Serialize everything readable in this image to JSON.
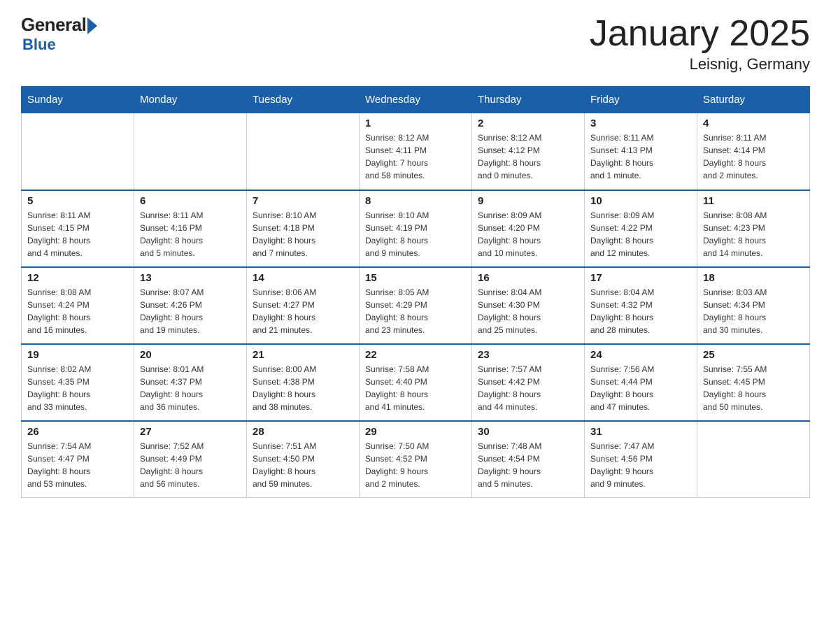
{
  "header": {
    "logo_general": "General",
    "logo_blue": "Blue",
    "title": "January 2025",
    "subtitle": "Leisnig, Germany"
  },
  "days_of_week": [
    "Sunday",
    "Monday",
    "Tuesday",
    "Wednesday",
    "Thursday",
    "Friday",
    "Saturday"
  ],
  "weeks": [
    [
      {
        "day": "",
        "info": ""
      },
      {
        "day": "",
        "info": ""
      },
      {
        "day": "",
        "info": ""
      },
      {
        "day": "1",
        "info": "Sunrise: 8:12 AM\nSunset: 4:11 PM\nDaylight: 7 hours\nand 58 minutes."
      },
      {
        "day": "2",
        "info": "Sunrise: 8:12 AM\nSunset: 4:12 PM\nDaylight: 8 hours\nand 0 minutes."
      },
      {
        "day": "3",
        "info": "Sunrise: 8:11 AM\nSunset: 4:13 PM\nDaylight: 8 hours\nand 1 minute."
      },
      {
        "day": "4",
        "info": "Sunrise: 8:11 AM\nSunset: 4:14 PM\nDaylight: 8 hours\nand 2 minutes."
      }
    ],
    [
      {
        "day": "5",
        "info": "Sunrise: 8:11 AM\nSunset: 4:15 PM\nDaylight: 8 hours\nand 4 minutes."
      },
      {
        "day": "6",
        "info": "Sunrise: 8:11 AM\nSunset: 4:16 PM\nDaylight: 8 hours\nand 5 minutes."
      },
      {
        "day": "7",
        "info": "Sunrise: 8:10 AM\nSunset: 4:18 PM\nDaylight: 8 hours\nand 7 minutes."
      },
      {
        "day": "8",
        "info": "Sunrise: 8:10 AM\nSunset: 4:19 PM\nDaylight: 8 hours\nand 9 minutes."
      },
      {
        "day": "9",
        "info": "Sunrise: 8:09 AM\nSunset: 4:20 PM\nDaylight: 8 hours\nand 10 minutes."
      },
      {
        "day": "10",
        "info": "Sunrise: 8:09 AM\nSunset: 4:22 PM\nDaylight: 8 hours\nand 12 minutes."
      },
      {
        "day": "11",
        "info": "Sunrise: 8:08 AM\nSunset: 4:23 PM\nDaylight: 8 hours\nand 14 minutes."
      }
    ],
    [
      {
        "day": "12",
        "info": "Sunrise: 8:08 AM\nSunset: 4:24 PM\nDaylight: 8 hours\nand 16 minutes."
      },
      {
        "day": "13",
        "info": "Sunrise: 8:07 AM\nSunset: 4:26 PM\nDaylight: 8 hours\nand 19 minutes."
      },
      {
        "day": "14",
        "info": "Sunrise: 8:06 AM\nSunset: 4:27 PM\nDaylight: 8 hours\nand 21 minutes."
      },
      {
        "day": "15",
        "info": "Sunrise: 8:05 AM\nSunset: 4:29 PM\nDaylight: 8 hours\nand 23 minutes."
      },
      {
        "day": "16",
        "info": "Sunrise: 8:04 AM\nSunset: 4:30 PM\nDaylight: 8 hours\nand 25 minutes."
      },
      {
        "day": "17",
        "info": "Sunrise: 8:04 AM\nSunset: 4:32 PM\nDaylight: 8 hours\nand 28 minutes."
      },
      {
        "day": "18",
        "info": "Sunrise: 8:03 AM\nSunset: 4:34 PM\nDaylight: 8 hours\nand 30 minutes."
      }
    ],
    [
      {
        "day": "19",
        "info": "Sunrise: 8:02 AM\nSunset: 4:35 PM\nDaylight: 8 hours\nand 33 minutes."
      },
      {
        "day": "20",
        "info": "Sunrise: 8:01 AM\nSunset: 4:37 PM\nDaylight: 8 hours\nand 36 minutes."
      },
      {
        "day": "21",
        "info": "Sunrise: 8:00 AM\nSunset: 4:38 PM\nDaylight: 8 hours\nand 38 minutes."
      },
      {
        "day": "22",
        "info": "Sunrise: 7:58 AM\nSunset: 4:40 PM\nDaylight: 8 hours\nand 41 minutes."
      },
      {
        "day": "23",
        "info": "Sunrise: 7:57 AM\nSunset: 4:42 PM\nDaylight: 8 hours\nand 44 minutes."
      },
      {
        "day": "24",
        "info": "Sunrise: 7:56 AM\nSunset: 4:44 PM\nDaylight: 8 hours\nand 47 minutes."
      },
      {
        "day": "25",
        "info": "Sunrise: 7:55 AM\nSunset: 4:45 PM\nDaylight: 8 hours\nand 50 minutes."
      }
    ],
    [
      {
        "day": "26",
        "info": "Sunrise: 7:54 AM\nSunset: 4:47 PM\nDaylight: 8 hours\nand 53 minutes."
      },
      {
        "day": "27",
        "info": "Sunrise: 7:52 AM\nSunset: 4:49 PM\nDaylight: 8 hours\nand 56 minutes."
      },
      {
        "day": "28",
        "info": "Sunrise: 7:51 AM\nSunset: 4:50 PM\nDaylight: 8 hours\nand 59 minutes."
      },
      {
        "day": "29",
        "info": "Sunrise: 7:50 AM\nSunset: 4:52 PM\nDaylight: 9 hours\nand 2 minutes."
      },
      {
        "day": "30",
        "info": "Sunrise: 7:48 AM\nSunset: 4:54 PM\nDaylight: 9 hours\nand 5 minutes."
      },
      {
        "day": "31",
        "info": "Sunrise: 7:47 AM\nSunset: 4:56 PM\nDaylight: 9 hours\nand 9 minutes."
      },
      {
        "day": "",
        "info": ""
      }
    ]
  ]
}
